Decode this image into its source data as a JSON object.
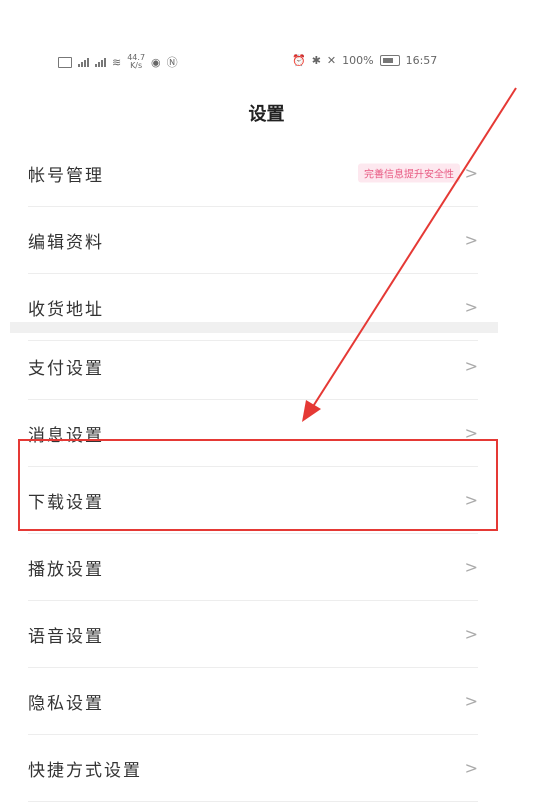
{
  "status_bar": {
    "network_speed": "44.7",
    "speed_unit": "K/s",
    "battery_percent": "100%",
    "time": "16:57"
  },
  "header": {
    "title": "设置"
  },
  "group1": [
    {
      "label": "帐号管理",
      "badge": "完善信息提升安全性"
    },
    {
      "label": "编辑资料"
    },
    {
      "label": "收货地址"
    }
  ],
  "group2": [
    {
      "label": "支付设置"
    },
    {
      "label": "消息设置"
    },
    {
      "label": "下载设置"
    },
    {
      "label": "播放设置"
    },
    {
      "label": "语音设置"
    },
    {
      "label": "隐私设置"
    },
    {
      "label": "快捷方式设置"
    }
  ],
  "chevron": ">",
  "annotation": {
    "box_color": "#e53935",
    "arrow_color": "#e53935"
  }
}
